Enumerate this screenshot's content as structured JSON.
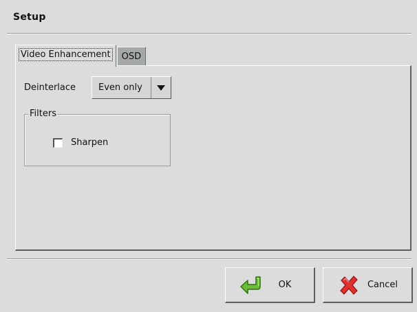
{
  "window": {
    "title": "Setup"
  },
  "tabs": [
    {
      "label": "Video Enhancement",
      "active": true
    },
    {
      "label": "OSD",
      "active": false
    }
  ],
  "deinterlace": {
    "label": "Deinterlace",
    "value": "Even only"
  },
  "filters": {
    "title": "Filters",
    "sharpen": {
      "label": "Sharpen",
      "checked": false
    }
  },
  "buttons": {
    "ok": {
      "label": "OK",
      "icon": "enter-arrow-icon",
      "color": "#5aa02c"
    },
    "cancel": {
      "label": "Cancel",
      "icon": "red-x-icon",
      "color": "#d42020"
    }
  }
}
